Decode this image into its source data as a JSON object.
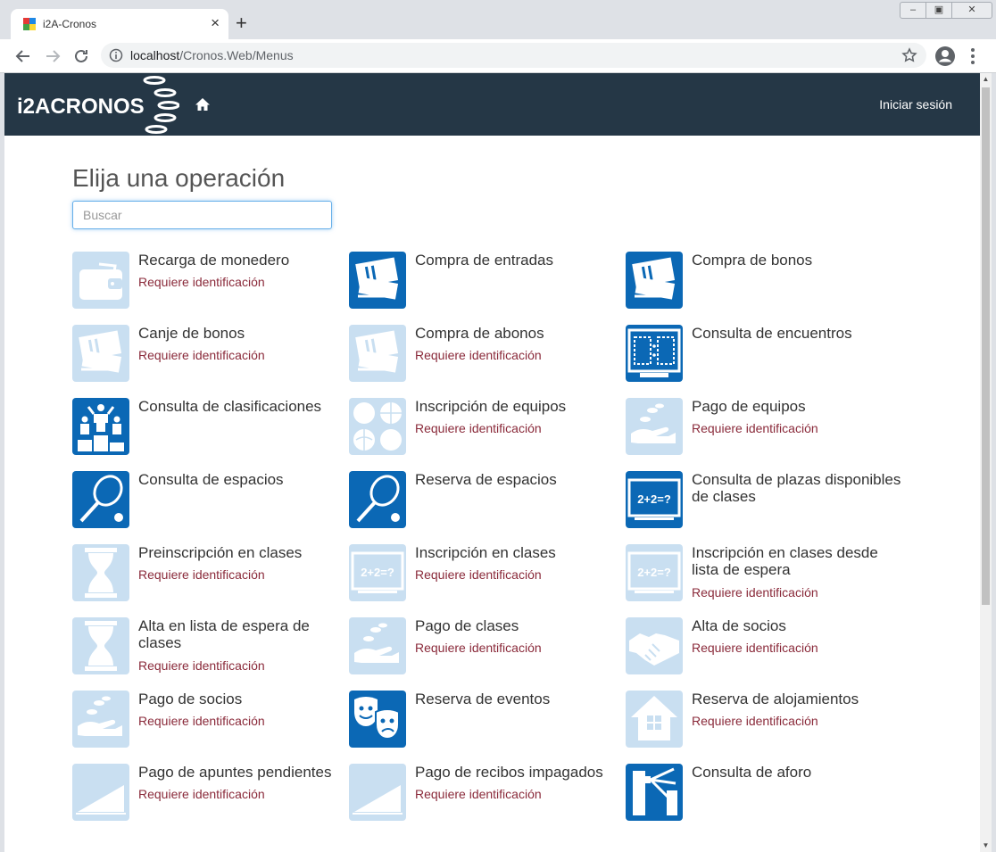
{
  "browser": {
    "tab_title": "i2A-Cronos",
    "url_host": "localhost",
    "url_path": "/Cronos.Web/Menus"
  },
  "navbar": {
    "brand": "i2ACRONOS",
    "login": "Iniciar sesión"
  },
  "page": {
    "heading": "Elija una operación",
    "search_placeholder": "Buscar"
  },
  "colors": {
    "navbar_bg": "#253746",
    "icon_active": "#0b68b5",
    "icon_inactive": "#c9dff1",
    "requirement_text": "#8a2a3a"
  },
  "operations": [
    {
      "title": "Recarga de monedero",
      "subtitle": "Requiere identificación",
      "icon": "wallet-icon",
      "enabled": false
    },
    {
      "title": "Compra de entradas",
      "subtitle": "",
      "icon": "tickets-icon",
      "enabled": true
    },
    {
      "title": "Compra de bonos",
      "subtitle": "",
      "icon": "tickets-icon",
      "enabled": true
    },
    {
      "title": "Canje de bonos",
      "subtitle": "Requiere identificación",
      "icon": "tickets-icon",
      "enabled": false
    },
    {
      "title": "Compra de abonos",
      "subtitle": "Requiere identificación",
      "icon": "tickets-icon",
      "enabled": false
    },
    {
      "title": "Consulta de encuentros",
      "subtitle": "",
      "icon": "scoreboard-icon",
      "enabled": true
    },
    {
      "title": "Consulta de clasificaciones",
      "subtitle": "",
      "icon": "podium-icon",
      "enabled": true
    },
    {
      "title": "Inscripción de equipos",
      "subtitle": "Requiere identificación",
      "icon": "balls-icon",
      "enabled": false
    },
    {
      "title": "Pago de equipos",
      "subtitle": "Requiere identificación",
      "icon": "hand-coins-icon",
      "enabled": false
    },
    {
      "title": "Consulta de espacios",
      "subtitle": "",
      "icon": "racket-icon",
      "enabled": true
    },
    {
      "title": "Reserva de espacios",
      "subtitle": "",
      "icon": "racket-icon",
      "enabled": true
    },
    {
      "title": "Consulta de plazas disponibles de clases",
      "subtitle": "",
      "icon": "blackboard-icon",
      "enabled": true
    },
    {
      "title": "Preinscripción en clases",
      "subtitle": "Requiere identificación",
      "icon": "hourglass-icon",
      "enabled": false
    },
    {
      "title": "Inscripción en clases",
      "subtitle": "Requiere identificación",
      "icon": "blackboard-icon",
      "enabled": false
    },
    {
      "title": "Inscripción en clases desde lista de espera",
      "subtitle": "Requiere identificación",
      "icon": "blackboard-icon",
      "enabled": false
    },
    {
      "title": "Alta en lista de espera de clases",
      "subtitle": "Requiere identificación",
      "icon": "hourglass-icon",
      "enabled": false
    },
    {
      "title": "Pago de clases",
      "subtitle": "Requiere identificación",
      "icon": "hand-coins-icon",
      "enabled": false
    },
    {
      "title": "Alta de socios",
      "subtitle": "Requiere identificación",
      "icon": "handshake-icon",
      "enabled": false
    },
    {
      "title": "Pago de socios",
      "subtitle": "Requiere identificación",
      "icon": "hand-coins-icon",
      "enabled": false
    },
    {
      "title": "Reserva de eventos",
      "subtitle": "",
      "icon": "theater-masks-icon",
      "enabled": true
    },
    {
      "title": "Reserva de alojamientos",
      "subtitle": "Requiere identificación",
      "icon": "house-icon",
      "enabled": false
    },
    {
      "title": "Pago de apuntes pendientes",
      "subtitle": "Requiere identificación",
      "icon": "ramp-icon",
      "enabled": false
    },
    {
      "title": "Pago de recibos impagados",
      "subtitle": "Requiere identificación",
      "icon": "ramp-icon",
      "enabled": false
    },
    {
      "title": "Consulta de aforo",
      "subtitle": "",
      "icon": "turnstile-icon",
      "enabled": true
    }
  ]
}
